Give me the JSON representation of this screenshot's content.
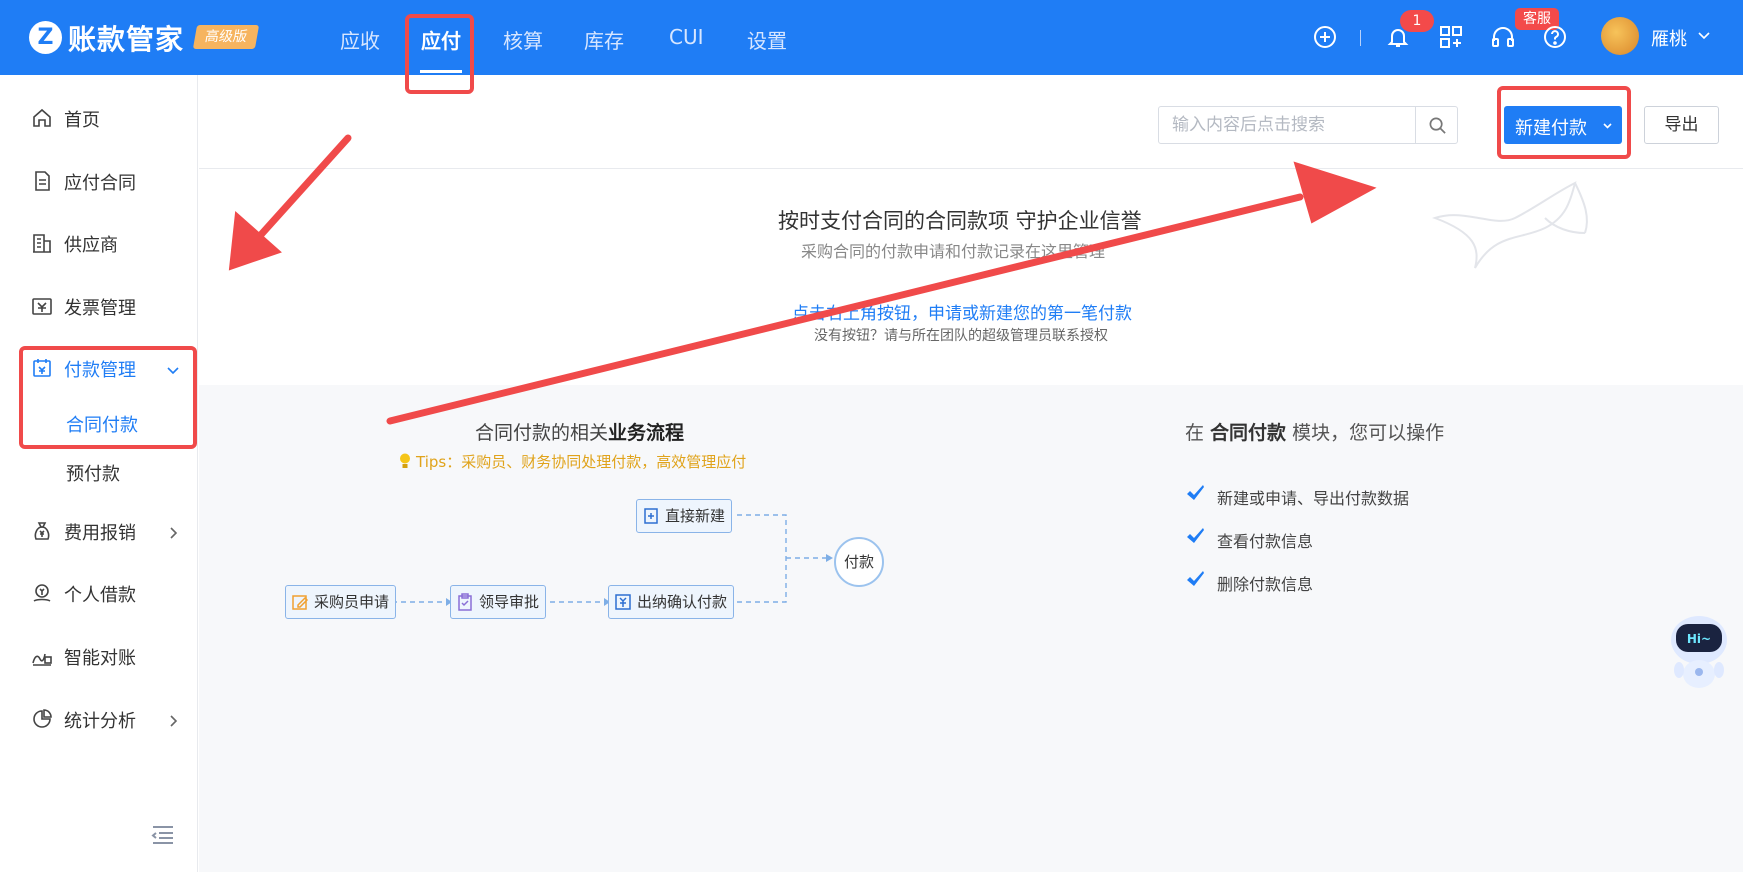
{
  "app": {
    "logo_letter": "Z",
    "name": "账款管家",
    "edition": "高级版"
  },
  "topnav": {
    "items": [
      {
        "label": "应收",
        "active": false
      },
      {
        "label": "应付",
        "active": true
      },
      {
        "label": "核算",
        "active": false
      },
      {
        "label": "库存",
        "active": false
      },
      {
        "label": "CUI",
        "active": false
      },
      {
        "label": "设置",
        "active": false
      }
    ]
  },
  "header_right": {
    "notification_count": "1",
    "service_label": "客服",
    "user_name": "雁桃",
    "icons": [
      "add-circle-icon",
      "bell-icon",
      "apps-grid-icon",
      "headset-icon",
      "help-icon"
    ]
  },
  "sidebar": {
    "items": [
      {
        "label": "首页",
        "icon": "home-icon"
      },
      {
        "label": "应付合同",
        "icon": "document-icon"
      },
      {
        "label": "供应商",
        "icon": "building-icon"
      },
      {
        "label": "发票管理",
        "icon": "invoice-icon"
      },
      {
        "label": "付款管理",
        "icon": "payment-calendar-icon",
        "expanded": true
      },
      {
        "label": "费用报销",
        "icon": "money-bag-icon"
      },
      {
        "label": "个人借款",
        "icon": "loan-icon"
      },
      {
        "label": "智能对账",
        "icon": "reconcile-icon"
      },
      {
        "label": "统计分析",
        "icon": "pie-chart-icon"
      }
    ],
    "sub_items": [
      {
        "label": "合同付款",
        "active": true
      },
      {
        "label": "预付款",
        "active": false
      }
    ]
  },
  "toolbar": {
    "search_placeholder": "输入内容后点击搜索",
    "new_button": "新建付款",
    "export_button": "导出"
  },
  "empty_state": {
    "title": "按时支付合同的合同款项 守护企业信誉",
    "subtitle": "采购合同的付款申请和付款记录在这里管理",
    "link": "点击右上角按钮，申请或新建您的第一笔付款",
    "note": "没有按钮？请与所在团队的超级管理员联系授权"
  },
  "flow": {
    "title_prefix": "合同付款的相关",
    "title_bold": "业务流程",
    "tips": "Tips：采购员、财务协同处理付款，高效管理应付",
    "nodes": {
      "apply": "采购员申请",
      "approve": "领导审批",
      "confirm": "出纳确认付款",
      "direct": "直接新建",
      "pay": "付款"
    }
  },
  "ops": {
    "title_prefix": "在 ",
    "title_bold": "合同付款",
    "title_suffix": " 模块，您可以操作",
    "items": [
      "新建或申请、导出付款数据",
      "查看付款信息",
      "删除付款信息"
    ]
  },
  "assistant": {
    "label": "Hi~"
  },
  "colors": {
    "primary": "#1f7df5",
    "annotation": "#f04a4a",
    "edition_badge": "#f6b45f",
    "tips": "#e0a31b"
  }
}
